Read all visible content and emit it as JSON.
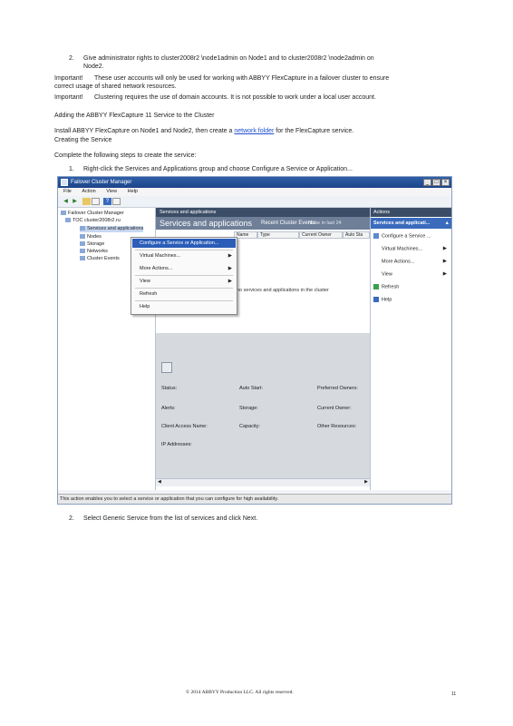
{
  "text": {
    "step2_line1_num": "2.",
    "step2_line1": "Give administrator rights to cluster2008r2 \\node1admin on Node1 and to cluster2008r2 \\node2admin on",
    "step2_line2": "Node2.",
    "important1_label": "Important!",
    "important1_line1": "These user accounts will only be used for working with ABBYY FlexCapture in a failover cluster to ensure",
    "important1_line2": "correct usage of shared network resources.",
    "important2_label": "Important!",
    "important2_line": "Clustering requires the use of domain accounts. It is not possible to work under a local user account.",
    "heading": "Adding the ABBYY FlexCapture 11 Service to the Cluster",
    "install_pre": "Install ABBYY FlexCapture on Node1 and Node2, then create a",
    "install_link": "network folder",
    "install_post": "for the FlexCapture service.",
    "creating_line": "Creating the Service",
    "complete_line": "Complete the following steps to create the service:",
    "step1_num": "1.",
    "step1_text": "Right-click the Services and Applications group and choose Configure a Service or Application...",
    "step2b_num": "2.",
    "step2b_text": "Select Generic Service from the list of services and click Next.",
    "footer": "© 2014 ABBYY Production LLC. All rights reserved.",
    "page_number": "11"
  },
  "window": {
    "title": "Failover Cluster Manager",
    "buttons": [
      "_",
      "□",
      "×"
    ],
    "menu": [
      "File",
      "Action",
      "View",
      "Help"
    ],
    "tree": {
      "root": "Failover Cluster Manager",
      "cluster": "TOC cluster2008r2.ru",
      "items": [
        "Services and applications",
        "Nodes",
        "Storage",
        "Networks",
        "Cluster Events"
      ]
    },
    "center": {
      "header": "Services and applications",
      "subheader": "Services and applications",
      "recent_events": "Recent Cluster Events:",
      "none_label": "None in last 24",
      "columns": [
        "Name",
        "Type",
        "Current Owner",
        "Auto Sta"
      ],
      "empty_message": "no services and applications in the cluster",
      "details": {
        "status": "Status:",
        "auto_start": "Auto Start:",
        "preferred_owners": "Preferred Owners:",
        "alerts": "Alerts:",
        "storage": "Storage:",
        "current_owner": "Current Owner:",
        "client_access_name": "Client Access Name:",
        "capacity": "Capacity:",
        "other_resources": "Other Resources:",
        "ip_addresses": "IP Addresses:"
      }
    },
    "actions": {
      "header": "Actions",
      "subheader": "Services and applicati...",
      "items": [
        "Configure a Service ...",
        "Virtual Machines...",
        "More Actions...",
        "View",
        "Refresh",
        "Help"
      ]
    },
    "context_menu": [
      "Configure a Service or Application...",
      "Virtual Machines...",
      "More Actions...",
      "View",
      "Refresh",
      "Help"
    ],
    "status_bar": "This action enables you to select a service or application that you can configure for high availability."
  },
  "colors": {
    "title_bar": "#2f5fa8",
    "highlight": "#2b5db8",
    "link": "#1f4fd0"
  }
}
